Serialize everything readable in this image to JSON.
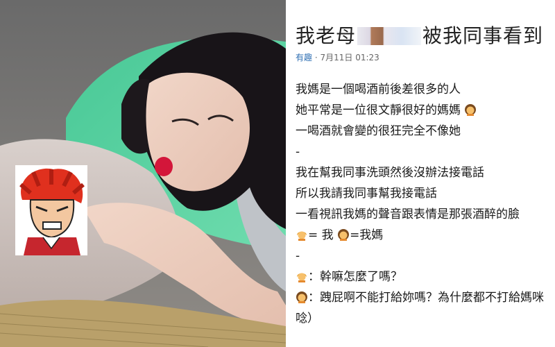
{
  "post": {
    "title_left": "我老母",
    "title_right": "被我同事看到",
    "category": "有趣",
    "date": "7月11日 01:23"
  },
  "body": {
    "lines": [
      "我媽是一個喝酒前後差很多的人",
      "她平常是一位很文靜很好的媽媽",
      "一喝酒就會變的很狂完全不像她",
      "-",
      "我在幫我同事洗頭然後沒辦法接電話",
      "所以我請我同事幫我接電話",
      "一看視訊我媽的聲音跟表情是那張酒醉的臉",
      "= 我 ",
      "=我媽",
      "-",
      "：幹嘛怎麼了嗎？",
      "：跩屁啊不能打給妳嗎？為什麼都不打給媽咪",
      "唸）"
    ]
  },
  "icons": {
    "woman_emoji": "woman-emoji-icon",
    "girl_emoji": "girl-emoji-icon",
    "sticker": "angry-redhead-sticker"
  },
  "colors": {
    "pillow": "#5fd3a5",
    "lipstick": "#d3163a",
    "category_link": "#2f6fb3"
  }
}
